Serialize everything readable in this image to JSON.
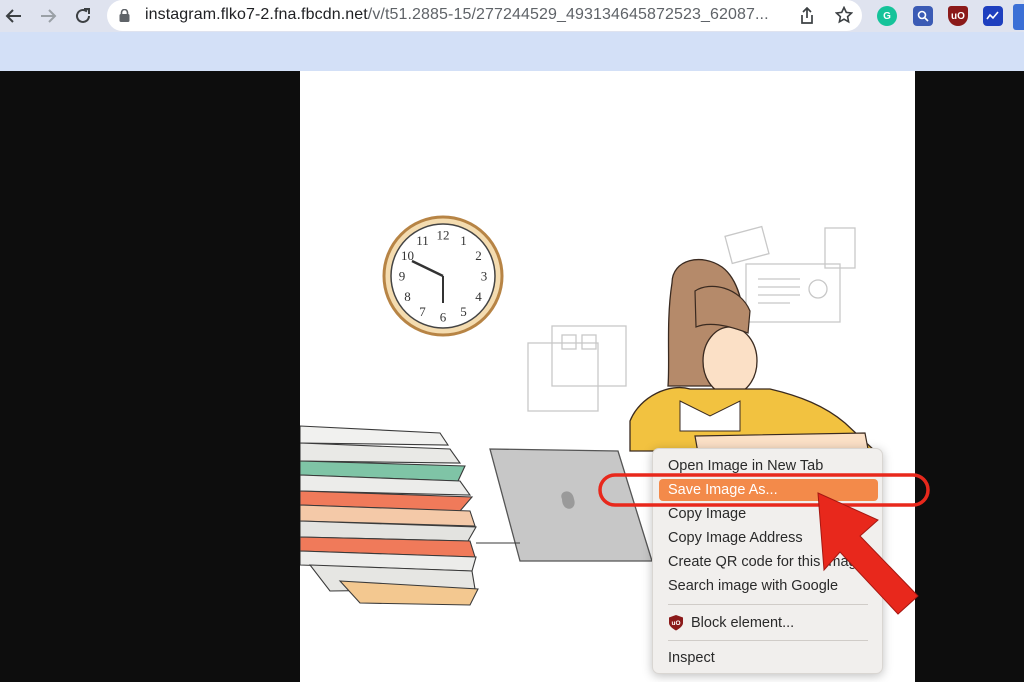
{
  "browser": {
    "url_host": "instagram.flko7-2.fna.fbcdn.net",
    "url_path": "/v/t51.2885-15/277244529_493134645872523_62087..."
  },
  "extensions": [
    "grammarly-icon",
    "search-extension-icon",
    "ublock-icon",
    "trend-extension-icon"
  ],
  "clock": {
    "numbers": [
      "12",
      "1",
      "2",
      "3",
      "4",
      "5",
      "6",
      "7",
      "8",
      "9",
      "10",
      "11"
    ]
  },
  "context_menu": {
    "items": [
      {
        "label": "Open Image in New Tab",
        "highlighted": false
      },
      {
        "label": "Save Image As...",
        "highlighted": true
      },
      {
        "label": "Copy Image",
        "highlighted": false
      },
      {
        "label": "Copy Image Address",
        "highlighted": false
      },
      {
        "label": "Create QR code for this Imag",
        "highlighted": false
      },
      {
        "label": "Search image with Google",
        "highlighted": false
      }
    ],
    "block_element": "Block element...",
    "inspect": "Inspect",
    "highlight_color": "#f38a4a"
  },
  "annotation": {
    "color": "#e8281c"
  }
}
